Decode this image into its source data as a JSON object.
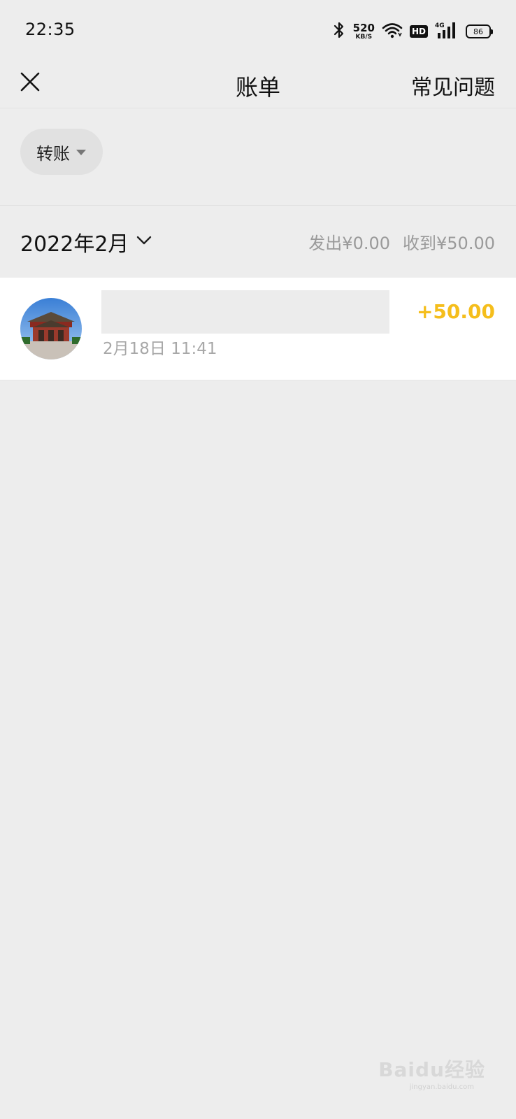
{
  "status_bar": {
    "time": "22:35",
    "net_speed_value": "520",
    "net_speed_unit": "KB/S",
    "hd_label": "HD",
    "network_label": "4G",
    "battery_level": "86",
    "icons": [
      "bluetooth-icon",
      "wifi-icon",
      "hd-icon",
      "signal-icon",
      "battery-icon"
    ]
  },
  "navbar": {
    "title": "账单",
    "right_action": "常见问题",
    "left_icon": "close-icon"
  },
  "filter": {
    "label": "转账",
    "icon": "caret-down-icon"
  },
  "month_section": {
    "month": "2022年2月",
    "outgoing_label": "发出¥0.00",
    "incoming_label": "收到¥50.00"
  },
  "bills": [
    {
      "time": "2月18日 11:41",
      "amount": "+50.00"
    }
  ],
  "colors": {
    "background": "#ededed",
    "amount_income": "#f5be1c",
    "secondary_text": "#9a9a9a"
  },
  "watermark": {
    "text": "Baidu经验",
    "sub": "jingyan.baidu.com"
  }
}
